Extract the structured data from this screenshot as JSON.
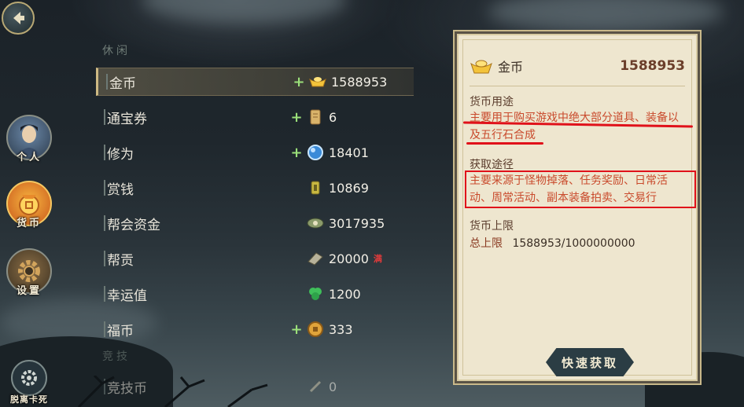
{
  "nav": {
    "character_label": "个人",
    "currency_label": "货币",
    "settings_label": "设置",
    "unstuck_label": "脱离卡死"
  },
  "list": {
    "section_leisure": "休闲",
    "section_competitive": "竞技",
    "rows": [
      {
        "name": "金币",
        "plus": "+",
        "value": "1588953"
      },
      {
        "name": "通宝券",
        "plus": "+",
        "value": "6"
      },
      {
        "name": "修为",
        "plus": "+",
        "value": "18401"
      },
      {
        "name": "赏钱",
        "plus": "",
        "value": "10869"
      },
      {
        "name": "帮会资金",
        "plus": "",
        "value": "3017935"
      },
      {
        "name": "帮贡",
        "plus": "",
        "value": "20000",
        "badge": "满"
      },
      {
        "name": "幸运值",
        "plus": "",
        "value": "1200"
      },
      {
        "name": "福币",
        "plus": "+",
        "value": "333"
      }
    ],
    "partial_row": {
      "name": "竞技币",
      "value": "0"
    }
  },
  "panel": {
    "title": "金币",
    "total": "1588953",
    "usage_label": "货币用途",
    "usage_text": "主要用于购买游戏中绝大部分道具、装备以及五行石合成",
    "source_label": "获取途径",
    "source_text": "主要来源于怪物掉落、任务奖励、日常活动、周常活动、副本装备拍卖、交易行",
    "limit_label": "货币上限",
    "limit_prefix": "总上限",
    "limit_value": "1588953/1000000000",
    "quick_button": "快速获取"
  },
  "colors": {
    "accent_gold": "#cdb984",
    "annotation_red": "#e0111a",
    "plus_green": "#9be07a"
  }
}
